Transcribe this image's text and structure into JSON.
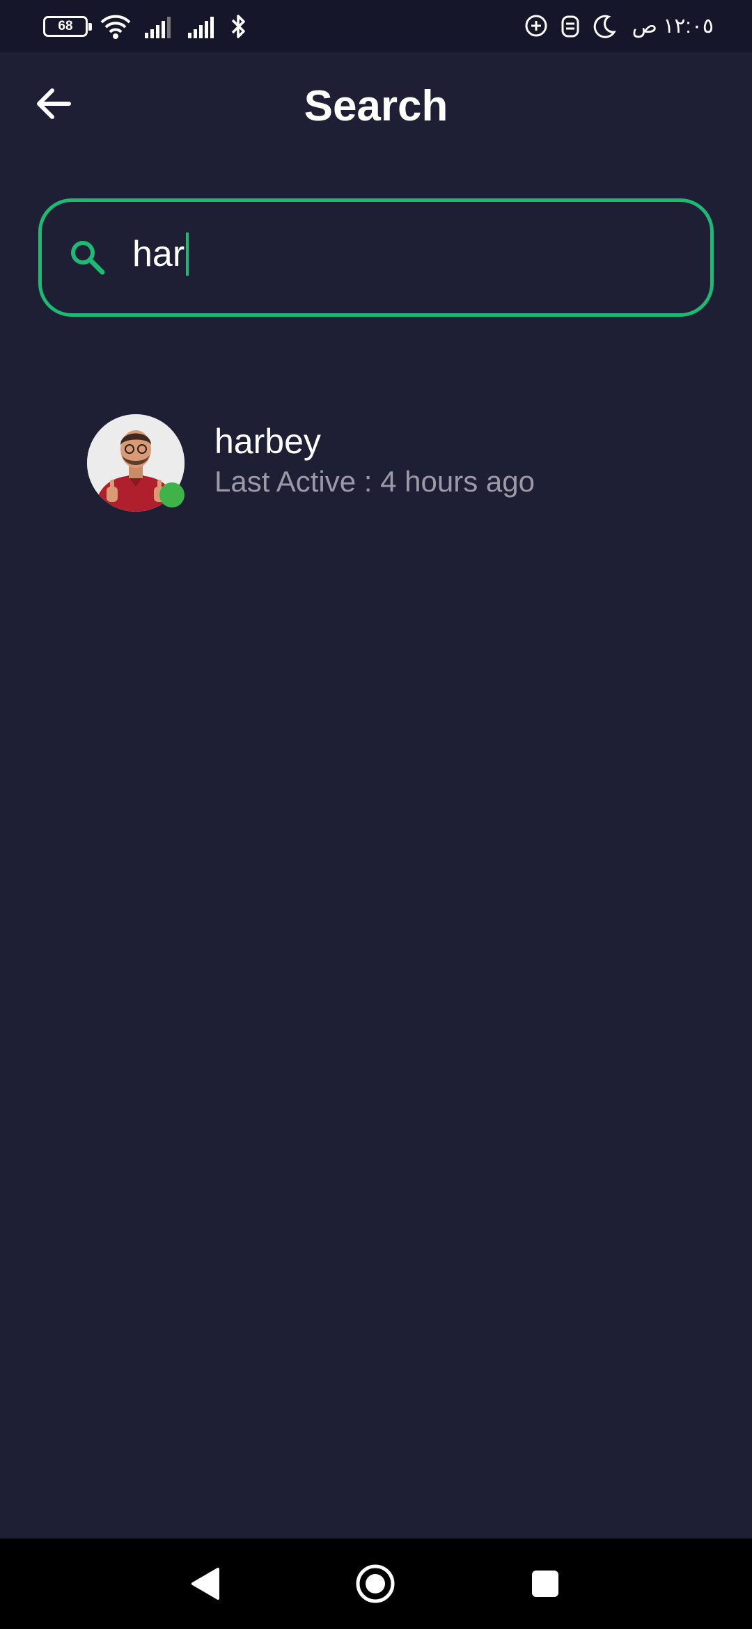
{
  "status_bar": {
    "battery": "68",
    "clock": "١٢:٠٥ ص",
    "icons_left": [
      "battery-icon",
      "wifi-icon",
      "signal-icon",
      "signal-icon",
      "bluetooth-icon"
    ],
    "icons_right": [
      "chat-add-icon",
      "vpn-icon",
      "moon-icon"
    ]
  },
  "header": {
    "title": "Search",
    "back_icon": "arrow-left-icon"
  },
  "search": {
    "value": "har",
    "icon": "search-icon"
  },
  "results": [
    {
      "name": "harbey",
      "status": "Last Active : 4 hours ago",
      "online": true
    }
  ],
  "nav_bar": {
    "icons": [
      "back-triangle-icon",
      "home-circle-icon",
      "recents-square-icon"
    ]
  },
  "colors": {
    "background": "#1e1e34",
    "accent": "#1dba74",
    "online": "#3fb24a",
    "muted_text": "#9a9aa8"
  }
}
